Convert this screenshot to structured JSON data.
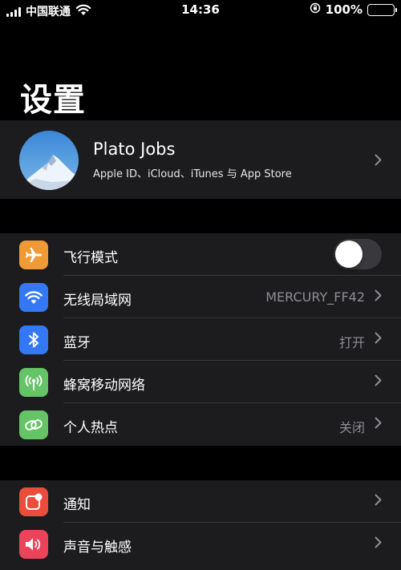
{
  "status_bar": {
    "carrier": "中国联通",
    "time": "14:36",
    "battery_percent": "100%",
    "icons": [
      "signal-bars-icon",
      "wifi-icon",
      "orientation-lock-icon",
      "battery-charging-icon"
    ]
  },
  "page_title": "设置",
  "profile": {
    "name": "Plato Jobs",
    "subtitle": "Apple ID、iCloud、iTunes 与 App Store"
  },
  "settings_group_1": [
    {
      "label": "飞行模式",
      "icon": "airplane-icon",
      "color": "#f09a37",
      "toggle": false
    },
    {
      "label": "无线局域网",
      "icon": "wifi-icon",
      "color": "#3478f6",
      "value": "MERCURY_FF42"
    },
    {
      "label": "蓝牙",
      "icon": "bluetooth-icon",
      "color": "#3478f6",
      "value": "打开"
    },
    {
      "label": "蜂窝移动网络",
      "icon": "cellular-antenna-icon",
      "color": "#65c466"
    },
    {
      "label": "个人热点",
      "icon": "hotspot-chain-icon",
      "color": "#65c466",
      "value": "关闭"
    }
  ],
  "settings_group_2": [
    {
      "label": "通知",
      "icon": "notifications-icon",
      "color": "#eb4d3d"
    },
    {
      "label": "声音与触感",
      "icon": "speaker-icon",
      "color": "#eb445a"
    }
  ]
}
